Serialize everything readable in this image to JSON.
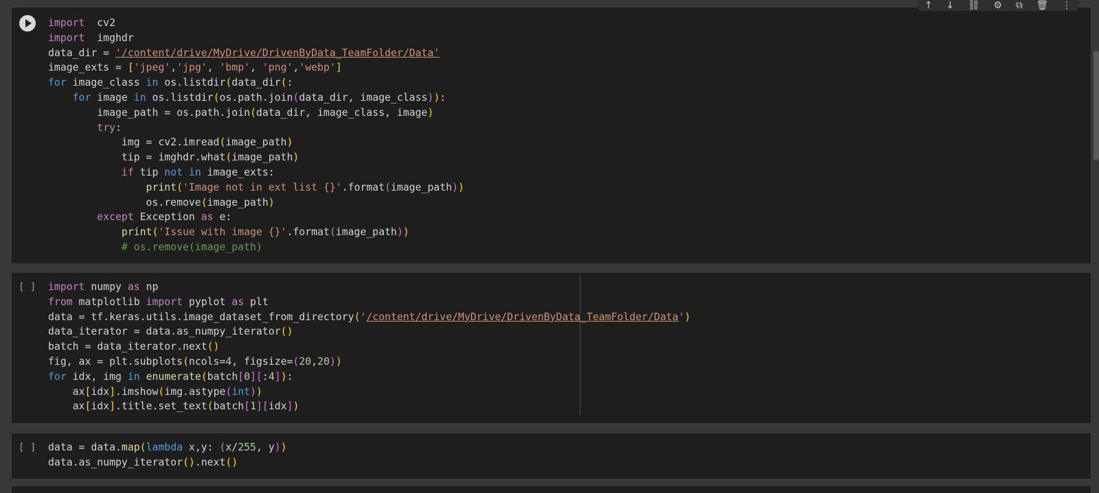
{
  "toolbar": {
    "move_up": "↑",
    "move_down": "↓",
    "link": "⛓",
    "settings": "⚙",
    "mirror": "⧉",
    "delete": "🗑",
    "more": "⋮"
  },
  "cells": [
    {
      "run_state": "run-icon",
      "lines": [
        [
          [
            "kw",
            "import"
          ],
          [
            "",
            "  cv2"
          ]
        ],
        [
          [
            "kw",
            "import"
          ],
          [
            "",
            "  imghdr"
          ]
        ],
        [
          [
            "",
            "data_dir = "
          ],
          [
            "str ul",
            "'/content/drive/MyDrive/DrivenByData_TeamFolder/Data'"
          ]
        ],
        [
          [
            "",
            "image_exts = "
          ],
          [
            "p1",
            "["
          ],
          [
            "str",
            "'jpeg'"
          ],
          [
            "",
            ","
          ],
          [
            "str",
            "'jpg'"
          ],
          [
            "",
            ", "
          ],
          [
            "str",
            "'bmp'"
          ],
          [
            "",
            ", "
          ],
          [
            "str",
            "'png'"
          ],
          [
            "",
            ","
          ],
          [
            "str",
            "'webp'"
          ],
          [
            "p1",
            "]"
          ]
        ],
        [
          [
            "ctl",
            "for"
          ],
          [
            "",
            " image_class "
          ],
          [
            "ctl",
            "in"
          ],
          [
            "",
            " os.listdir"
          ],
          [
            "p1",
            "("
          ],
          [
            "",
            "data_dir"
          ],
          [
            "p1",
            "("
          ],
          [
            "",
            ":"
          ]
        ],
        [
          [
            "",
            "    "
          ],
          [
            "ctl",
            "for"
          ],
          [
            "",
            " image "
          ],
          [
            "ctl",
            "in"
          ],
          [
            "",
            " os.listdir"
          ],
          [
            "p1",
            "("
          ],
          [
            "",
            "os.path.join"
          ],
          [
            "p2",
            "("
          ],
          [
            "",
            "data_dir, image_class"
          ],
          [
            "p2",
            ")"
          ],
          [
            "p1",
            ")"
          ],
          [
            "",
            ":"
          ]
        ],
        [
          [
            "",
            "        image_path = os.path.join"
          ],
          [
            "p1",
            "("
          ],
          [
            "",
            "data_dir, image_class, image"
          ],
          [
            "p1",
            ")"
          ]
        ],
        [
          [
            "",
            "        "
          ],
          [
            "kw",
            "try"
          ],
          [
            "",
            ":"
          ]
        ],
        [
          [
            "",
            "            img = cv2.imread"
          ],
          [
            "p1",
            "("
          ],
          [
            "",
            "image_path"
          ],
          [
            "p1",
            ")"
          ]
        ],
        [
          [
            "",
            "            tip = imghdr.what"
          ],
          [
            "p1",
            "("
          ],
          [
            "",
            "image_path"
          ],
          [
            "p1",
            ")"
          ]
        ],
        [
          [
            "",
            "            "
          ],
          [
            "kw",
            "if"
          ],
          [
            "",
            " tip "
          ],
          [
            "ctl",
            "not in"
          ],
          [
            "",
            " image_exts:"
          ]
        ],
        [
          [
            "",
            "                "
          ],
          [
            "fn",
            "print"
          ],
          [
            "p1",
            "("
          ],
          [
            "str",
            "'Image not in ext list {}'"
          ],
          [
            "",
            ".format"
          ],
          [
            "p2",
            "("
          ],
          [
            "",
            "image_path"
          ],
          [
            "p2",
            ")"
          ],
          [
            "p1",
            ")"
          ]
        ],
        [
          [
            "",
            "                os.remove"
          ],
          [
            "p1",
            "("
          ],
          [
            "",
            "image_path"
          ],
          [
            "p1",
            ")"
          ]
        ],
        [
          [
            "",
            "        "
          ],
          [
            "kw",
            "except"
          ],
          [
            "",
            " Exception "
          ],
          [
            "kw",
            "as"
          ],
          [
            "",
            " e:"
          ]
        ],
        [
          [
            "",
            "            "
          ],
          [
            "fn",
            "print"
          ],
          [
            "p1",
            "("
          ],
          [
            "str",
            "'Issue with image {}'"
          ],
          [
            "",
            ".format"
          ],
          [
            "p2",
            "("
          ],
          [
            "",
            "image_path"
          ],
          [
            "p2",
            ")"
          ],
          [
            "p1",
            ")"
          ]
        ],
        [
          [
            "",
            "            "
          ],
          [
            "cmt",
            "# os.remove(image_path)"
          ]
        ]
      ]
    },
    {
      "run_state": "[ ]",
      "lines": [
        [
          [
            "kw",
            "import"
          ],
          [
            "",
            " numpy "
          ],
          [
            "kw",
            "as"
          ],
          [
            "",
            " np"
          ]
        ],
        [
          [
            "kw",
            "from"
          ],
          [
            "",
            " matplotlib "
          ],
          [
            "kw",
            "import"
          ],
          [
            "",
            " pyplot "
          ],
          [
            "kw",
            "as"
          ],
          [
            "",
            " plt"
          ]
        ],
        [
          [
            "",
            "data = tf.keras.utils.image_dataset_from_directory"
          ],
          [
            "p1",
            "("
          ],
          [
            "str",
            "'"
          ],
          [
            "str ul",
            "/content/drive/MyDrive/DrivenByData_TeamFolder/Data"
          ],
          [
            "str",
            "'"
          ],
          [
            "p1",
            ")"
          ]
        ],
        [
          [
            "",
            "data_iterator = data.as_numpy_iterator"
          ],
          [
            "p1",
            "()"
          ]
        ],
        [
          [
            "",
            "batch = data_iterator.next"
          ],
          [
            "p1",
            "()"
          ]
        ],
        [
          [
            "",
            "fig, ax = plt.subplots"
          ],
          [
            "p1",
            "("
          ],
          [
            "",
            "ncols="
          ],
          [
            "num",
            "4"
          ],
          [
            "",
            ", figsize="
          ],
          [
            "p2",
            "("
          ],
          [
            "num",
            "20"
          ],
          [
            "",
            ","
          ],
          [
            "num",
            "20"
          ],
          [
            "p2",
            ")"
          ],
          [
            "p1",
            ")"
          ]
        ],
        [
          [
            "ctl",
            "for"
          ],
          [
            "",
            " idx, img "
          ],
          [
            "ctl",
            "in"
          ],
          [
            "",
            " "
          ],
          [
            "fn",
            "enumerate"
          ],
          [
            "p1",
            "("
          ],
          [
            "",
            "batch"
          ],
          [
            "p2",
            "["
          ],
          [
            "num",
            "0"
          ],
          [
            "p2",
            "]"
          ],
          [
            "p2",
            "["
          ],
          [
            "",
            ":"
          ],
          [
            "num",
            "4"
          ],
          [
            "p2",
            "]"
          ],
          [
            "p1",
            ")"
          ],
          [
            "",
            ":"
          ]
        ],
        [
          [
            "",
            "    ax"
          ],
          [
            "p1",
            "["
          ],
          [
            "",
            "idx"
          ],
          [
            "p1",
            "]"
          ],
          [
            "",
            ".imshow"
          ],
          [
            "p1",
            "("
          ],
          [
            "",
            "img.astype"
          ],
          [
            "p2",
            "("
          ],
          [
            "ctl",
            "int"
          ],
          [
            "p2",
            ")"
          ],
          [
            "p1",
            ")"
          ]
        ],
        [
          [
            "",
            "    ax"
          ],
          [
            "p1",
            "["
          ],
          [
            "",
            "idx"
          ],
          [
            "p1",
            "]"
          ],
          [
            "",
            ".title.set_text"
          ],
          [
            "p1",
            "("
          ],
          [
            "",
            "batch"
          ],
          [
            "p2",
            "["
          ],
          [
            "num",
            "1"
          ],
          [
            "p2",
            "]"
          ],
          [
            "p2",
            "["
          ],
          [
            "",
            "idx"
          ],
          [
            "p2",
            "]"
          ],
          [
            "p1",
            ")"
          ]
        ]
      ]
    },
    {
      "run_state": "[ ]",
      "lines": [
        [
          [
            "",
            "data = data."
          ],
          [
            "fn",
            "map"
          ],
          [
            "p1",
            "("
          ],
          [
            "ctl",
            "lambda"
          ],
          [
            "",
            " x,y: "
          ],
          [
            "p2",
            "("
          ],
          [
            "",
            "x/"
          ],
          [
            "num",
            "255"
          ],
          [
            "",
            ", y"
          ],
          [
            "p2",
            ")"
          ],
          [
            "p1",
            ")"
          ]
        ],
        [
          [
            "",
            "data.as_numpy_iterator"
          ],
          [
            "p1",
            "()"
          ],
          [
            "",
            ".next"
          ],
          [
            "p1",
            "()"
          ]
        ]
      ]
    }
  ]
}
